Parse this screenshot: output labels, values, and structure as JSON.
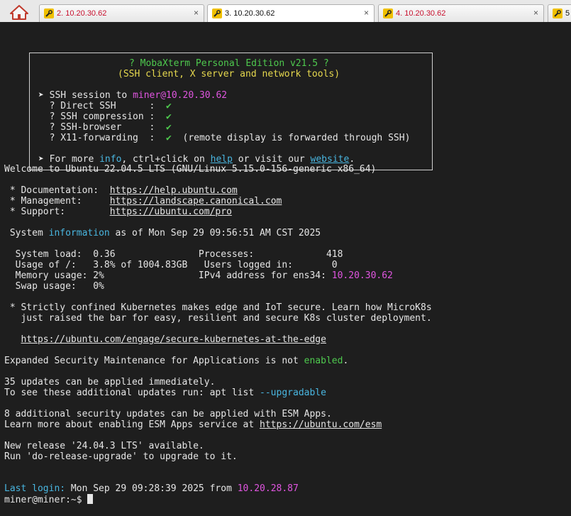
{
  "tabs": [
    {
      "label": "2. 10.20.30.62",
      "close": "×",
      "active": false
    },
    {
      "label": "3. 10.20.30.62",
      "close": "×",
      "active": true
    },
    {
      "label": "4. 10.20.30.62",
      "close": "×",
      "active": false
    },
    {
      "label": "5",
      "close": "",
      "active": false
    }
  ],
  "colors": {
    "terminal_bg": "#1e1e1e",
    "text": "#e6e6e6",
    "green": "#4ec94e",
    "yellow": "#e6d84e",
    "magenta": "#e055e0",
    "cyan": "#49b6e0",
    "tab_label_red": "#c8102e"
  },
  "banner": {
    "title": "? MobaXterm Personal Edition v21.5 ?",
    "subtitle": "(SSH client, X server and network tools)",
    "session_prefix": "➤ SSH session to ",
    "session_target": "miner@10.20.30.62",
    "features": [
      {
        "label": "  ? Direct SSH      :  ",
        "check": "✔",
        "note": ""
      },
      {
        "label": "  ? SSH compression :  ",
        "check": "✔",
        "note": ""
      },
      {
        "label": "  ? SSH-browser     :  ",
        "check": "✔",
        "note": ""
      },
      {
        "label": "  ? X11-forwarding  :  ",
        "check": "✔",
        "note": "  (remote display is forwarded through SSH)"
      }
    ],
    "more_prefix": "➤ For more ",
    "more_info": "info",
    "more_mid": ", ctrl+click on ",
    "more_help": "help",
    "more_mid2": " or visit our ",
    "more_website": "website",
    "more_end": "."
  },
  "motd": {
    "welcome": "Welcome to Ubuntu 22.04.5 LTS (GNU/Linux 5.15.0-156-generic x86_64)",
    "doc_label": " * Documentation:  ",
    "doc_url": "https://help.ubuntu.com",
    "mgmt_label": " * Management:     ",
    "mgmt_url": "https://landscape.canonical.com",
    "support_label": " * Support:        ",
    "support_url": "https://ubuntu.com/pro",
    "sysinfo_prefix": " System ",
    "sysinfo_word": "information",
    "sysinfo_rest": " as of Mon Sep 29 09:56:51 AM CST 2025",
    "stat_load": "  System load:  0.36               Processes:             418",
    "stat_usage": "  Usage of /:   3.8% of 1004.83GB   Users logged in:       0",
    "stat_mem_prefix": "  Memory usage: 2%                 IPv4 address for ens34: ",
    "stat_mem_ip": "10.20.30.62",
    "stat_swap": "  Swap usage:   0%",
    "k8s_line1": " * Strictly confined Kubernetes makes edge and IoT secure. Learn how MicroK8s",
    "k8s_line2": "   just raised the bar for easy, resilient and secure K8s cluster deployment.",
    "k8s_url_indent": "   ",
    "k8s_url": "https://ubuntu.com/engage/secure-kubernetes-at-the-edge",
    "esm_prefix": "Expanded Security Maintenance for Applications is not ",
    "esm_word": "enabled",
    "esm_end": ".",
    "updates_line1": "35 updates can be applied immediately.",
    "updates_line2_prefix": "To see these additional updates run: apt list ",
    "updates_line2_flag": "--upgradable",
    "esm_apps_line1": "8 additional security updates can be applied with ESM Apps.",
    "esm_apps_line2_prefix": "Learn more about enabling ESM Apps service at ",
    "esm_apps_url": "https://ubuntu.com/esm",
    "release_line1": "New release '24.04.3 LTS' available.",
    "release_line2": "Run 'do-release-upgrade' to upgrade to it.",
    "last_login_label": "Last login:",
    "last_login_rest": " Mon Sep 29 09:28:39 2025 from ",
    "last_login_ip": "10.20.28.87",
    "prompt": "miner@miner:~$ "
  }
}
